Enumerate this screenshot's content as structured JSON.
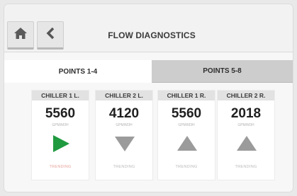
{
  "header": {
    "title": "FLOW DIAGNOSTICS",
    "home_icon": "home-icon",
    "back_icon": "chevron-left-icon"
  },
  "tabs": [
    {
      "label": "POINTS 1-4",
      "active": true
    },
    {
      "label": "POINTS 5-8",
      "active": false
    }
  ],
  "chillers": [
    {
      "label": "CHILLER 1 L.",
      "value": "5560",
      "unit": "GPM/M3H",
      "icon": "play-right-icon",
      "status": "TRENDING",
      "icon_color": "#1f9a3f",
      "status_color": "#e7a29a"
    },
    {
      "label": "CHILLER 2 L.",
      "value": "4120",
      "unit": "GPM/M3H",
      "icon": "triangle-down-icon",
      "status": "TRENDING",
      "icon_color": "#9b9b9b",
      "status_color": "#b9b9b9"
    },
    {
      "label": "CHILLER 1 R.",
      "value": "5560",
      "unit": "GPM/M3H",
      "icon": "triangle-up-icon",
      "status": "TRENDING",
      "icon_color": "#9b9b9b",
      "status_color": "#b9b9b9"
    },
    {
      "label": "CHILLER 2 R.",
      "value": "2018",
      "unit": "GPM/M3H",
      "icon": "triangle-up-icon",
      "status": "TRENDING",
      "icon_color": "#9b9b9b",
      "status_color": "#b9b9b9"
    }
  ],
  "colors": {
    "accent_green": "#1f9a3f",
    "neutral_icon": "#9b9b9b"
  }
}
